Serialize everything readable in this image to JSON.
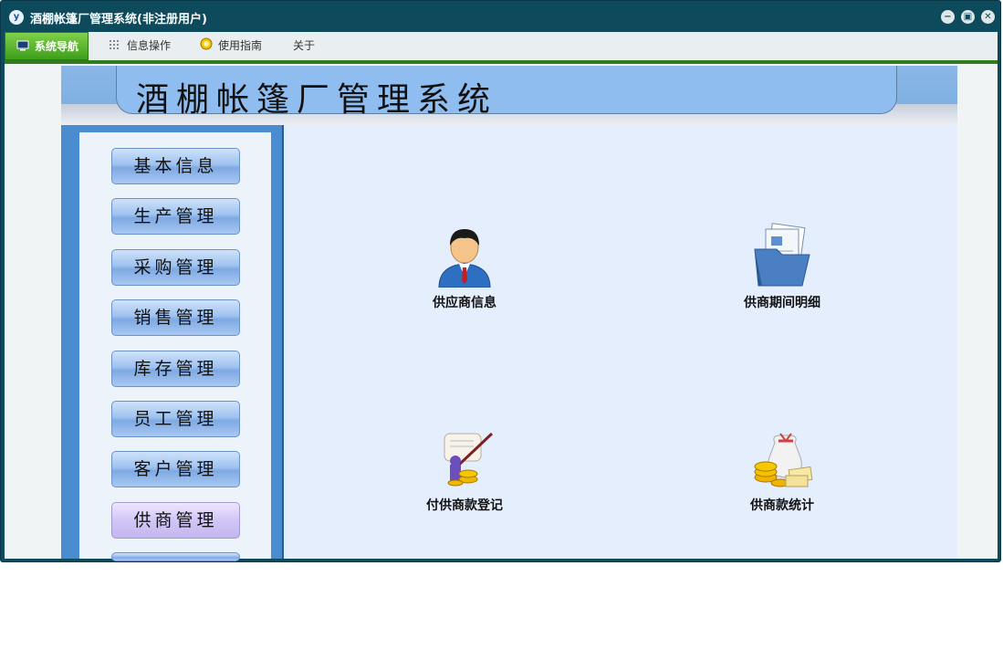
{
  "window": {
    "title": "酒棚帐篷厂管理系统(非注册用户)",
    "app_icon_glyph": "y"
  },
  "window_controls": {
    "minimize": "−",
    "restore": "▣",
    "close": "✕"
  },
  "menubar": {
    "items": [
      {
        "label": "系统导航",
        "icon": "monitor-icon"
      },
      {
        "label": "信息操作",
        "icon": "grid-icon"
      },
      {
        "label": "使用指南",
        "icon": "sun-icon"
      },
      {
        "label": "关于",
        "icon": ""
      }
    ]
  },
  "banner": {
    "title": "酒棚帐篷厂管理系统"
  },
  "sidebar": {
    "items": [
      {
        "label": "基本信息"
      },
      {
        "label": "生产管理"
      },
      {
        "label": "采购管理"
      },
      {
        "label": "销售管理"
      },
      {
        "label": "库存管理"
      },
      {
        "label": "员工管理"
      },
      {
        "label": "客户管理"
      },
      {
        "label": "供商管理"
      }
    ],
    "selected": "供商管理"
  },
  "tiles": [
    {
      "label": "供应商信息",
      "icon": "person-icon"
    },
    {
      "label": "供商期间明细",
      "icon": "documents-folder-icon"
    },
    {
      "label": "付供商款登记",
      "icon": "payment-register-icon"
    },
    {
      "label": "供商款统计",
      "icon": "money-bag-icon"
    }
  ],
  "colors": {
    "titlebar": "#0c4a5c",
    "menu_active": "#3f9e1c",
    "banner": "#8ab6e6",
    "sidebar_frame": "#4a8cd0",
    "main_bg": "#e4eefd"
  }
}
